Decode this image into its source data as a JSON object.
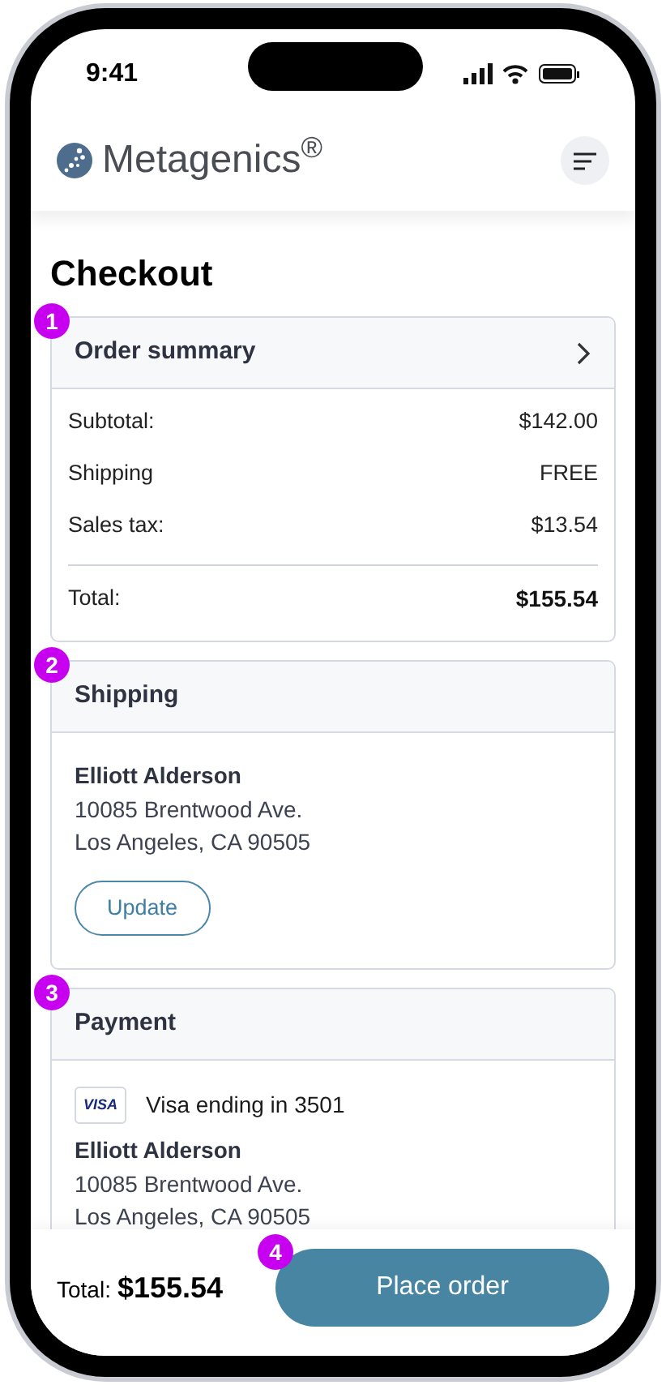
{
  "status_bar": {
    "time": "9:41"
  },
  "header": {
    "logo": "Metagenics$^{®}$"
  },
  "page_title": "Checkout",
  "sections": [
    {
      "kind": "summary",
      "badge": "1",
      "title": "Order summary",
      "rows": [
        {
          "label": "Subtotal:",
          "value": "$142.00"
        },
        {
          "label": "Shipping",
          "value": "FREE"
        },
        {
          "label": "Sales tax:",
          "value": "$13.54"
        }
      ],
      "total": {
        "label": "Total:",
        "value": "$155.54"
      }
    },
    {
      "kind": "address",
      "badge": "2",
      "title": "Shipping",
      "name": "Elliott Alderson",
      "lines": [
        "10085 Brentwood Ave.",
        "Los Angeles, CA 90505"
      ],
      "button": "Update"
    },
    {
      "kind": "payment",
      "badge": "3",
      "title": "Payment",
      "card_brand": "VISA",
      "card_text": "Visa ending in 3501",
      "name": "Elliott Alderson",
      "lines": [
        "10085 Brentwood Ave.",
        "Los Angeles, CA 90505"
      ]
    }
  ],
  "footer": {
    "total_label": "Total:",
    "total_value": "$155.54",
    "badge": "4",
    "button": "Place order"
  }
}
